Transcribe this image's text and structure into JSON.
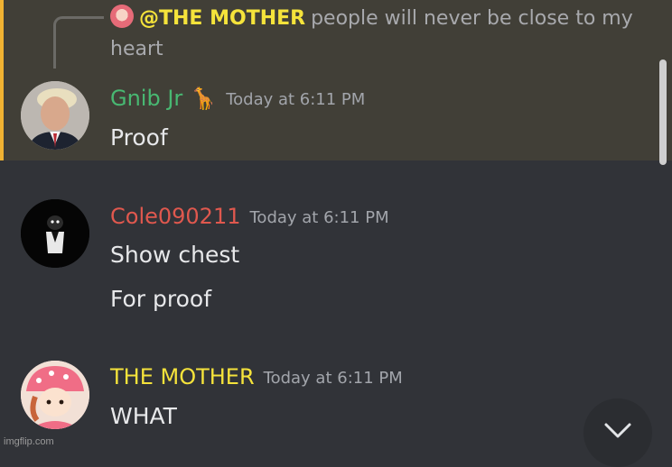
{
  "reply_preview": {
    "mention": "@THE MOTHER",
    "text": "people will never be close to my heart"
  },
  "messages": [
    {
      "username": "Gnib Jr",
      "username_color": "#48b872",
      "badge_icon": "giraffe-icon",
      "badge_glyph": "🦒",
      "timestamp": "Today at 6:11 PM",
      "lines": [
        "Proof"
      ],
      "highlighted": true
    },
    {
      "username": "Cole090211",
      "username_color": "#e0584e",
      "timestamp": "Today at 6:11 PM",
      "lines": [
        "Show chest",
        "For proof"
      ]
    },
    {
      "username": "THE MOTHER",
      "username_color": "#f5e33b",
      "timestamp": "Today at 6:11 PM",
      "lines": [
        "WHAT"
      ]
    }
  ],
  "jump_button_icon": "chevron-down-icon",
  "watermark": "imgflip.com",
  "colors": {
    "background": "#313338",
    "highlight": "#413f37",
    "highlight_bar": "#f0b232"
  }
}
